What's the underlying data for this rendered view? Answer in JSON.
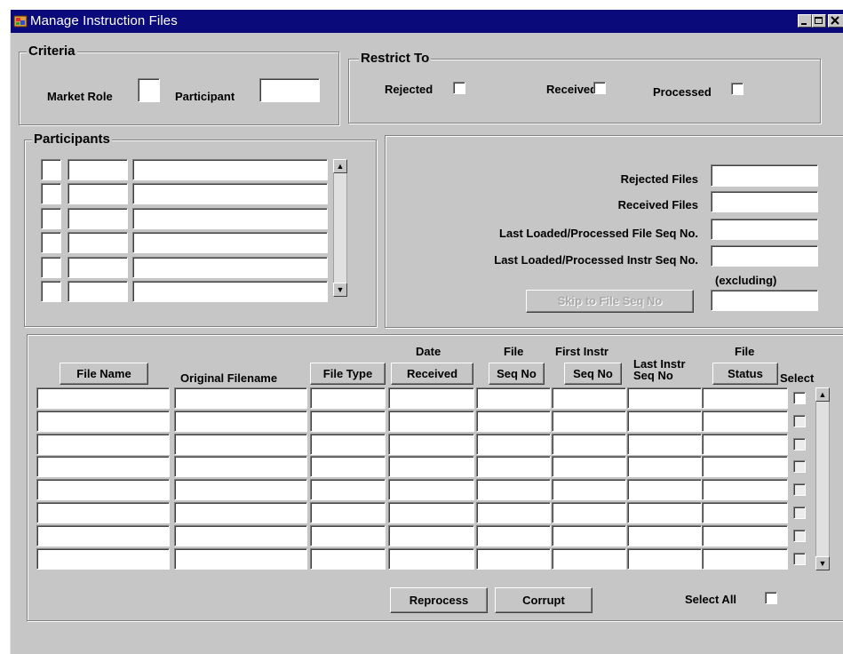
{
  "window": {
    "title": "Manage Instruction Files"
  },
  "criteria": {
    "title": "Criteria",
    "market_role_label": "Market Role",
    "participant_label": "Participant"
  },
  "restrict": {
    "title": "Restrict To",
    "rejected_label": "Rejected",
    "received_label": "Received",
    "processed_label": "Processed"
  },
  "participants": {
    "title": "Participants"
  },
  "summary": {
    "rejected_files_label": "Rejected Files",
    "received_files_label": "Received Files",
    "last_file_seq_label": "Last Loaded/Processed File Seq No.",
    "last_instr_seq_label": "Last Loaded/Processed Instr Seq No.",
    "excluding_label": "(excluding)",
    "skip_button": "Skip to File Seq No"
  },
  "files": {
    "col_file_name": "File Name",
    "col_original_filename": "Original Filename",
    "col_file_type": "File Type",
    "col_date_top": "Date",
    "col_date_btn": "Received",
    "col_seq_top": "File",
    "col_seq_btn": "Seq No",
    "col_first_top": "First Instr",
    "col_first_btn": "Seq No",
    "col_last_line1": "Last Instr",
    "col_last_line2": "Seq No",
    "col_status_top": "File",
    "col_status_btn": "Status",
    "col_select": "Select",
    "reprocess_button": "Reprocess",
    "corrupt_button": "Corrupt",
    "select_all_label": "Select All"
  },
  "icons": {
    "app": "app-icon",
    "minimize": "minimize-icon",
    "maximize": "maximize-icon",
    "close": "close-icon",
    "scroll_up": "arrow-up-icon",
    "scroll_down": "arrow-down-icon"
  },
  "colors": {
    "titlebar": "#0a0a7a",
    "face": "#c6c6c6"
  }
}
